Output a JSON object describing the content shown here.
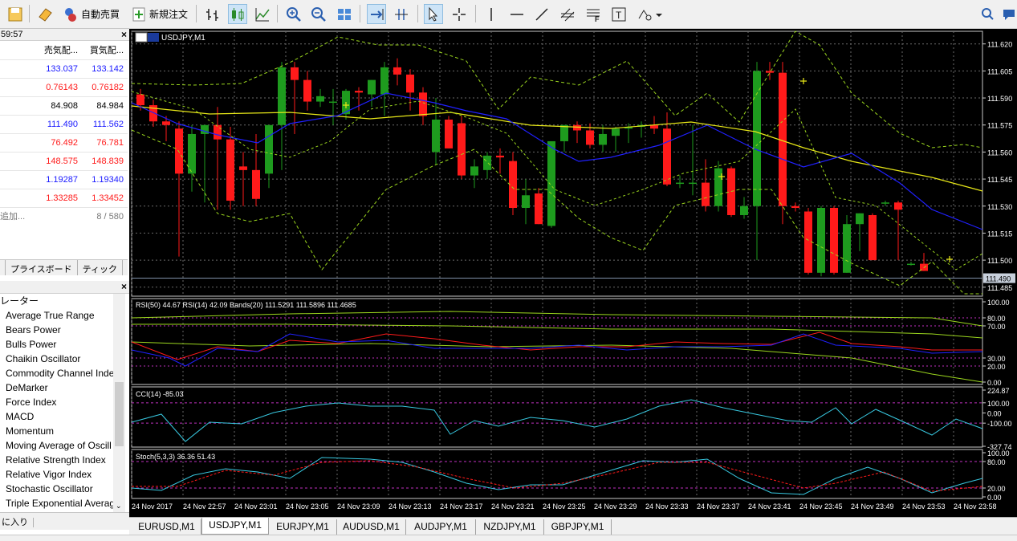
{
  "toolbar": {
    "auto_trade_label": "自動売買",
    "new_order_label": "新規注文"
  },
  "market_watch": {
    "time": "59:57",
    "col_bid": "売気配...",
    "col_ask": "買気配...",
    "rows": [
      {
        "bid": "133.037",
        "ask": "133.142",
        "color": "blue"
      },
      {
        "bid": "0.76143",
        "ask": "0.76182",
        "color": "red"
      },
      {
        "bid": "84.908",
        "ask": "84.984",
        "color": "black"
      },
      {
        "bid": "111.490",
        "ask": "111.562",
        "color": "blue"
      },
      {
        "bid": "76.492",
        "ask": "76.781",
        "color": "red"
      },
      {
        "bid": "148.575",
        "ask": "148.839",
        "color": "red"
      },
      {
        "bid": "1.19287",
        "ask": "1.19340",
        "color": "blue"
      },
      {
        "bid": "1.33285",
        "ask": "1.33452",
        "color": "red"
      }
    ],
    "add_label": "追加...",
    "count": "8 / 580",
    "tab_board": "プライスボード",
    "tab_tick": "ティック"
  },
  "navigator": {
    "category": "レーター",
    "items": [
      "Average True Range",
      "Bears Power",
      "Bulls Power",
      "Chaikin Oscillator",
      "Commodity Channel Inde",
      "DeMarker",
      "Force Index",
      "MACD",
      "Momentum",
      "Moving Average of Oscill",
      "Relative Strength Index",
      "Relative Vigor Index",
      "Stochastic Oscillator",
      "Triple Exponential Averag"
    ],
    "favorites_tab": "に入り"
  },
  "chart": {
    "title": "USDJPY,M1",
    "price_labels": [
      "111.620",
      "111.605",
      "111.590",
      "111.575",
      "111.560",
      "111.545",
      "111.530",
      "111.515",
      "111.500",
      "111.485"
    ],
    "current_price": "111.490",
    "rsi_label": "RSI(50) 44.67 RSI(14) 42.09 Bands(20) 111.5291 111.5896 111.4685",
    "rsi_levels": [
      "100.00",
      "80.00",
      "70.00",
      "30.00",
      "20.00",
      "0.00"
    ],
    "cci_label": "CCI(14) -85.03",
    "cci_levels": [
      "224.87",
      "100.00",
      "0.00",
      "-100.00",
      "-327.74"
    ],
    "stoch_label": "Stoch(5,3,3) 36.36 51.43",
    "stoch_levels": [
      "100.00",
      "80.00",
      "20.00",
      "0.00"
    ],
    "time_labels": [
      "24 Nov 2017",
      "24 Nov 22:57",
      "24 Nov 23:01",
      "24 Nov 23:05",
      "24 Nov 23:09",
      "24 Nov 23:13",
      "24 Nov 23:17",
      "24 Nov 23:21",
      "24 Nov 23:25",
      "24 Nov 23:29",
      "24 Nov 23:33",
      "24 Nov 23:37",
      "24 Nov 23:41",
      "24 Nov 23:45",
      "24 Nov 23:49",
      "24 Nov 23:53",
      "24 Nov 23:58"
    ]
  },
  "chart_tabs": [
    "EURUSD,M1",
    "USDJPY,M1",
    "EURJPY,M1",
    "AUDUSD,M1",
    "AUDJPY,M1",
    "NZDJPY,M1",
    "GBPJPY,M1"
  ],
  "active_tab": "USDJPY,M1",
  "colors": {
    "bull": "#1e9b1e",
    "bear": "#ff1a1a",
    "ma_yellow": "#e8e818",
    "ma_blue": "#2020ff",
    "bands": "#9bd61e",
    "grid": "#6a6a6a"
  }
}
